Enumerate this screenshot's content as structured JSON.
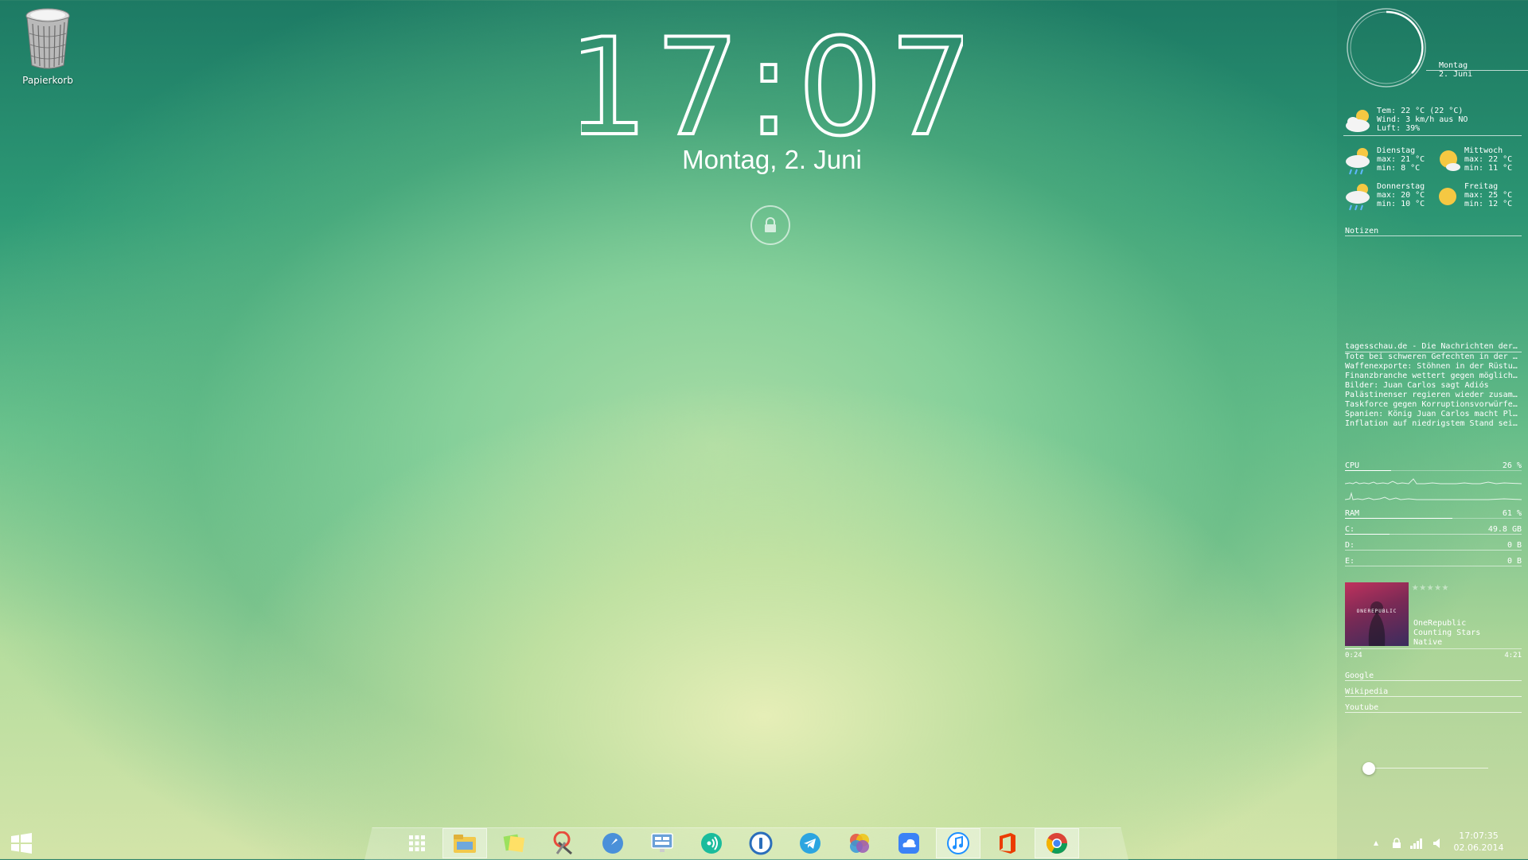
{
  "desktop": {
    "recycle_bin_label": "Papierkorb"
  },
  "lockscreen": {
    "time": "17:07",
    "date": "Montag, 2. Juni"
  },
  "sidebar": {
    "calendar": {
      "weekday": "Montag",
      "date": "2. Juni"
    },
    "weather_now": {
      "temp": "Tem: 22 °C (22 °C)",
      "wind": "Wind: 3 km/h aus NO",
      "humidity": "Luft: 39%"
    },
    "forecast": [
      {
        "day": "Dienstag",
        "max": "max: 21 °C",
        "min": "min:  8 °C",
        "icon": "rain-cloud-icon"
      },
      {
        "day": "Mittwoch",
        "max": "max: 22 °C",
        "min": "min:  11 °C",
        "icon": "sun-cloud-icon"
      },
      {
        "day": "Donnerstag",
        "max": "max: 20 °C",
        "min": "min:  10 °C",
        "icon": "rain-cloud-icon"
      },
      {
        "day": "Freitag",
        "max": "max: 25 °C",
        "min": "min:  12 °C",
        "icon": "sun-icon"
      }
    ],
    "notes_label": "Notizen",
    "news": {
      "source": "tagesschau.de - Die Nachrichten der ARD",
      "items": [
        "Tote bei schweren Gefechten in der Ostu...",
        "Waffenexporte: Stöhnen in der Rüstungsb...",
        "Finanzbranche wettert gegen mögliche EZ...",
        "Bilder: Juan Carlos sagt Adiós",
        "Palästinenser regieren wieder zusammen",
        "Taskforce gegen Korruptionsvorwürfe am...",
        "Spanien: König Juan Carlos macht Platz fü...",
        "Inflation auf niedrigstem Stand seit 2010"
      ]
    },
    "system": {
      "cpu_label": "CPU",
      "cpu_value": "26 %",
      "cpu_fraction": 0.26,
      "ram_label": "RAM",
      "ram_value": "61 %",
      "ram_fraction": 0.61,
      "drives": [
        {
          "label": "C:",
          "value": "49.8 GB",
          "fraction": 0.25
        },
        {
          "label": "D:",
          "value": "0 B",
          "fraction": 0
        },
        {
          "label": "E:",
          "value": "0 B",
          "fraction": 0
        }
      ]
    },
    "music": {
      "album_art_text": "ONEREPUBLIC",
      "artist": "OneRepublic",
      "title": "Counting Stars",
      "album": "Native",
      "elapsed": "0:24",
      "duration": "4:21",
      "progress_fraction": 0.09,
      "rating_stars": 0,
      "rating_max": 5
    },
    "links": [
      "Google",
      "Wikipedia",
      "Youtube"
    ],
    "volume_fraction": 0.0
  },
  "taskbar": {
    "clock_time": "17:07:35",
    "clock_date": "02.06.2014",
    "dock_icons": [
      "apps-grid-icon",
      "file-explorer-icon",
      "sticky-notes-icon",
      "snipping-tool-icon",
      "rocket-launcher-icon",
      "remote-desktop-icon",
      "audio-app-icon",
      "password-manager-icon",
      "telegram-icon",
      "picasa-icon",
      "icloud-icon",
      "itunes-icon",
      "office-icon",
      "chrome-icon"
    ]
  }
}
